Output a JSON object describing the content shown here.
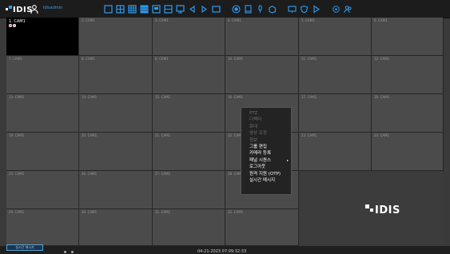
{
  "toolbar": {
    "logo_text": "IDIS",
    "user_label": "Idisadmin",
    "icons": [
      {
        "name": "layout-1x1-icon"
      },
      {
        "name": "layout-2x2-icon"
      },
      {
        "name": "layout-3x3-icon"
      },
      {
        "name": "layout-4x4-icon"
      },
      {
        "name": "layout-5x5-icon"
      },
      {
        "name": "layout-custom-a-icon"
      },
      {
        "name": "layout-custom-b-icon"
      },
      {
        "name": "prev-group-icon"
      },
      {
        "name": "next-group-icon"
      },
      {
        "name": "fullscreen-icon"
      },
      {
        "name": "record-icon"
      },
      {
        "name": "alarm-icon"
      },
      {
        "name": "mic-icon"
      },
      {
        "name": "cube-icon"
      },
      {
        "name": "display-icon"
      },
      {
        "name": "shield-icon"
      },
      {
        "name": "play-icon"
      },
      {
        "name": "settings-icon"
      },
      {
        "name": "users-icon"
      }
    ]
  },
  "cameras": [
    {
      "label": "1. CAM1"
    },
    {
      "label": "2. CAM1"
    },
    {
      "label": "3. CAM1"
    },
    {
      "label": "4. CAM1"
    },
    {
      "label": "5. CAM1"
    },
    {
      "label": "6. CAM1"
    },
    {
      "label": "7. CAM1"
    },
    {
      "label": "8. CAM1"
    },
    {
      "label": "9. CAM1"
    },
    {
      "label": "10. CAM1"
    },
    {
      "label": "11. CAM1"
    },
    {
      "label": "12. CAM1"
    },
    {
      "label": "13. CAM1"
    },
    {
      "label": "14. CAM1"
    },
    {
      "label": "15. CAM1"
    },
    {
      "label": "16. CAM1"
    },
    {
      "label": "17. CAM1"
    },
    {
      "label": "18. CAM1"
    },
    {
      "label": "19. CAM1"
    },
    {
      "label": "20. CAM1"
    },
    {
      "label": "21. CAM1"
    },
    {
      "label": "22. CAM1"
    },
    {
      "label": "23. CAM1"
    },
    {
      "label": "24. CAM1"
    },
    {
      "label": "25. CAM1"
    },
    {
      "label": "26. CAM1"
    },
    {
      "label": "27. CAM1"
    },
    {
      "label": "28. CAM1"
    },
    {
      "label": "29. CAM1"
    },
    {
      "label": "30. CAM1"
    },
    {
      "label": "31. CAM1"
    },
    {
      "label": "32. CAM1"
    }
  ],
  "big_cell": {
    "logo_text": "IDIS"
  },
  "context_menu": {
    "items": [
      {
        "label": "PTZ",
        "enabled": false,
        "submenu": false
      },
      {
        "label": "디펙터",
        "enabled": false,
        "submenu": false
      },
      {
        "label": "화대",
        "enabled": false,
        "submenu": false
      },
      {
        "label": "영상 조정",
        "enabled": false,
        "submenu": false
      },
      {
        "label": "정보",
        "enabled": false,
        "submenu": false
      },
      {
        "label": "그룹 편집",
        "enabled": true,
        "submenu": false
      },
      {
        "label": "카메라 등록",
        "enabled": true,
        "submenu": false
      },
      {
        "label": "패널 시퀀스",
        "enabled": true,
        "submenu": true
      },
      {
        "label": "로그아웃",
        "enabled": true,
        "submenu": false
      },
      {
        "label": "원격 지원 (OTP)",
        "enabled": true,
        "submenu": false
      },
      {
        "label": "실시간 메시지",
        "enabled": true,
        "submenu": false
      }
    ]
  },
  "statusbar": {
    "live_message_label": "실시간 메시지",
    "datetime": "04-21-2023 07:09:32:33"
  },
  "colors": {
    "accent": "#2a9df4",
    "selected_cell": "#000000",
    "cell_bg": "#4b4b4b",
    "rec_red": "#e03030",
    "rec_pink": "#e06a8a"
  }
}
